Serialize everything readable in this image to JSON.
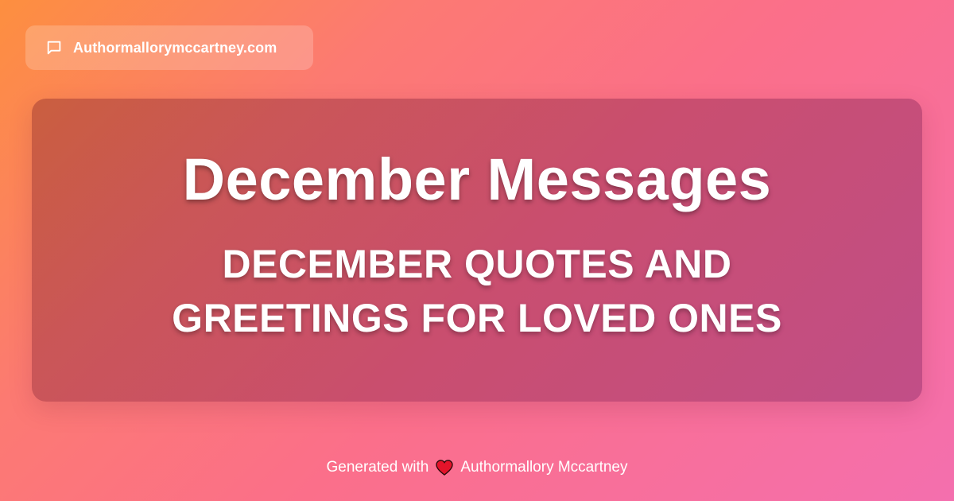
{
  "site": {
    "icon": "chat-bubble-icon",
    "domain": "Authormallorymccartney.com"
  },
  "card": {
    "title": "December Messages",
    "subtitle_line1": "DECEMBER QUOTES AND",
    "subtitle_line2": "GREETINGS FOR LOVED ONES"
  },
  "footer": {
    "prefix": "Generated with",
    "icon": "heart-icon",
    "author": "Authormallory Mccartney"
  },
  "colors": {
    "gradient_start": "#fd8f3f",
    "gradient_end": "#f46fae",
    "heart": "#e3132a",
    "text": "#ffffff"
  }
}
